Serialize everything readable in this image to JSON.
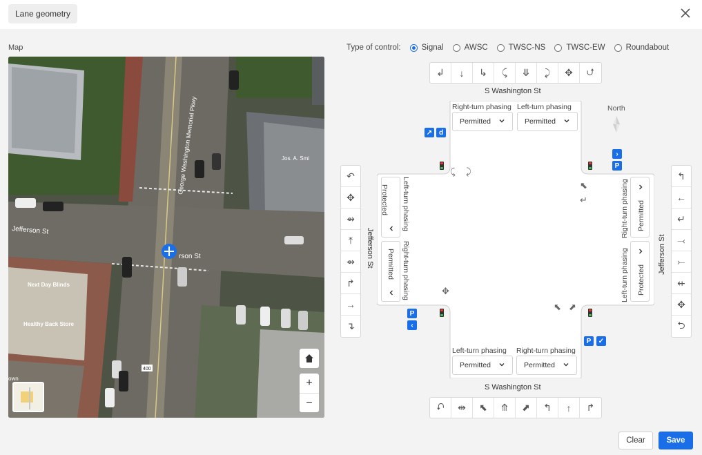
{
  "header": {
    "title": "Lane geometry"
  },
  "map": {
    "label": "Map",
    "street_labels": [
      "George Washington Memorial Pkwy",
      "Jefferson St",
      "rson St",
      "Jos. A. Smi"
    ],
    "business_labels": [
      "Next Day Blinds",
      "Healthy Back Store"
    ],
    "route_shield": "400",
    "overview_label": "own",
    "controls": {
      "home_icon": "home-icon",
      "zoom_in": "+",
      "zoom_out": "−"
    }
  },
  "control_type": {
    "label": "Type of control:",
    "options": [
      "Signal",
      "AWSC",
      "TWSC-NS",
      "TWSC-EW",
      "Roundabout"
    ],
    "selected": "Signal"
  },
  "north_label": "North",
  "streets": {
    "north": "S Washington St",
    "south": "S Washington St",
    "west": "Jefferson St",
    "east": "Jefferson St"
  },
  "phasing": {
    "north": {
      "right_label": "Right-turn phasing",
      "right_value": "Permitted",
      "left_label": "Left-turn phasing",
      "left_value": "Permitted"
    },
    "south": {
      "left_label": "Left-turn phasing",
      "left_value": "Permitted",
      "right_label": "Right-turn phasing",
      "right_value": "Permitted"
    },
    "west": {
      "left_label": "Left-turn phasing",
      "left_value": "Protected",
      "right_label": "Right-turn phasing",
      "right_value": "Permitted"
    },
    "east": {
      "right_label": "Right-turn phasing",
      "right_value": "Permitted",
      "left_label": "Left-turn phasing",
      "left_value": "Protected"
    }
  },
  "tags": {
    "nw": [
      "↗",
      "d"
    ],
    "ne": [
      "›",
      "P"
    ],
    "sw": [
      "P",
      "‹"
    ],
    "se": [
      "P",
      "✓"
    ]
  },
  "lane_buttons": {
    "top": [
      "↲",
      "↓",
      "↳",
      "⤹",
      "⤋",
      "⤸",
      "✥",
      "⮍"
    ],
    "bottom": [
      "⮏",
      "⇹",
      "⬉",
      "⤊",
      "⬈",
      "↰",
      "↑",
      "↱"
    ],
    "left": [
      "↶",
      "✥",
      "⇴",
      "⤒",
      "⇴",
      "↱",
      "→",
      "↴"
    ],
    "right": [
      "↰",
      "←",
      "↵",
      "⤙",
      "⤚",
      "⇷",
      "✥",
      "⮌"
    ]
  },
  "footer": {
    "clear": "Clear",
    "save": "Save"
  }
}
